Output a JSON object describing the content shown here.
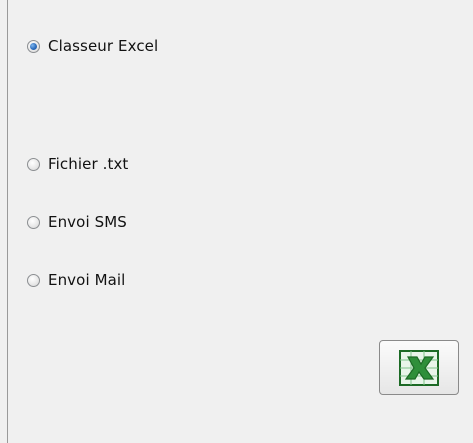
{
  "options": [
    {
      "label": "Classeur Excel",
      "checked": true
    },
    {
      "label": "Fichier .txt",
      "checked": false
    },
    {
      "label": "Envoi SMS",
      "checked": false
    },
    {
      "label": "Envoi Mail",
      "checked": false
    }
  ],
  "export_button": {
    "icon": "excel-icon",
    "colors": {
      "icon_green": "#2f8f3a",
      "icon_dark_green": "#1c6a25",
      "icon_light": "#e9f5ea"
    }
  },
  "colors": {
    "panel_background": "#f0f0f0",
    "radio_selected": "#2d6dbd"
  }
}
